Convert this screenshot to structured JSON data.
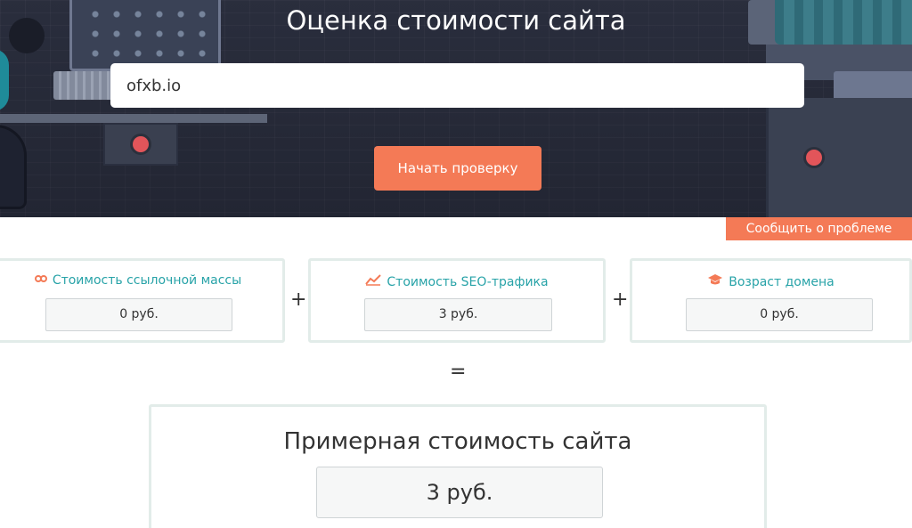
{
  "hero": {
    "title": "Оценка стоимости сайта",
    "url_value": "ofxb.io",
    "start_button_label": "Начать проверку"
  },
  "report_problem_label": "Сообщить о проблеме",
  "cards": [
    {
      "icon": "link-icon",
      "title": "Стоимость ссылочной массы",
      "value": "0 руб."
    },
    {
      "icon": "chart-icon",
      "title": "Стоимость SEO-трафика",
      "value": "3 руб."
    },
    {
      "icon": "graduation-cap-icon",
      "title": "Возраст домена",
      "value": "0 руб."
    }
  ],
  "operators": {
    "plus": "+",
    "equals": "="
  },
  "total": {
    "title": "Примерная стоимость сайта",
    "value": "3 руб."
  },
  "colors": {
    "accent": "#f47a56",
    "teal": "#28a3a8",
    "hero_bg": "#2a2e3d",
    "card_border": "#e2ece9"
  }
}
